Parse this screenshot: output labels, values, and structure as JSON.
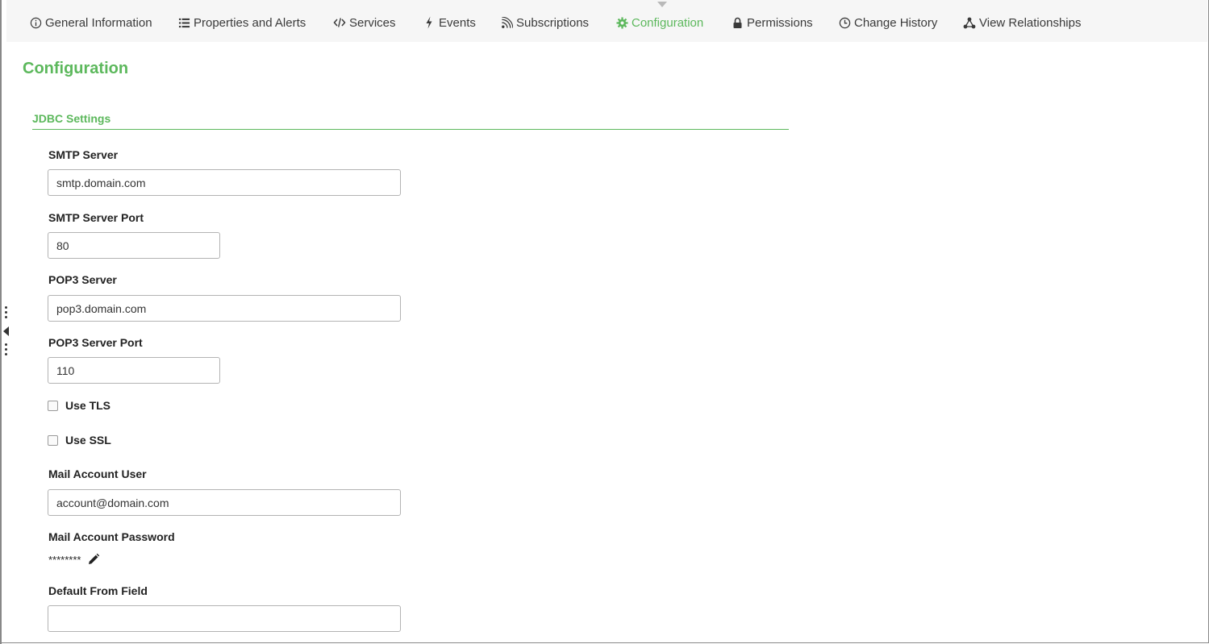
{
  "tabs": [
    {
      "label": "General Information",
      "icon": "info-circle-icon",
      "active": false
    },
    {
      "label": "Properties and Alerts",
      "icon": "list-icon",
      "active": false
    },
    {
      "label": "Services",
      "icon": "code-icon",
      "active": false
    },
    {
      "label": "Events",
      "icon": "lightning-bolt-icon",
      "active": false
    },
    {
      "label": "Subscriptions",
      "icon": "feed-icon",
      "active": false
    },
    {
      "label": "Configuration",
      "icon": "gear-icon",
      "active": true
    },
    {
      "label": "Permissions",
      "icon": "lock-icon",
      "active": false
    },
    {
      "label": "Change History",
      "icon": "clock-icon",
      "active": false
    },
    {
      "label": "View Relationships",
      "icon": "network-icon",
      "active": false
    }
  ],
  "page": {
    "title": "Configuration",
    "section_title": "JDBC Settings"
  },
  "fields": {
    "smtp_server": {
      "label": "SMTP Server",
      "value": "smtp.domain.com"
    },
    "smtp_port": {
      "label": "SMTP Server Port",
      "value": "80"
    },
    "pop3_server": {
      "label": "POP3 Server",
      "value": "pop3.domain.com"
    },
    "pop3_port": {
      "label": "POP3 Server Port",
      "value": "110"
    },
    "use_tls": {
      "label": "Use TLS",
      "checked": false
    },
    "use_ssl": {
      "label": "Use SSL",
      "checked": false
    },
    "mail_user": {
      "label": "Mail Account User",
      "value": "account@domain.com"
    },
    "mail_password": {
      "label": "Mail Account Password",
      "masked": "********"
    },
    "default_from": {
      "label": "Default From Field",
      "value": ""
    }
  },
  "colors": {
    "accent": "#5cb85c",
    "tab_text": "#3a3a3a",
    "tabbar_bg": "#f6f6f6"
  }
}
